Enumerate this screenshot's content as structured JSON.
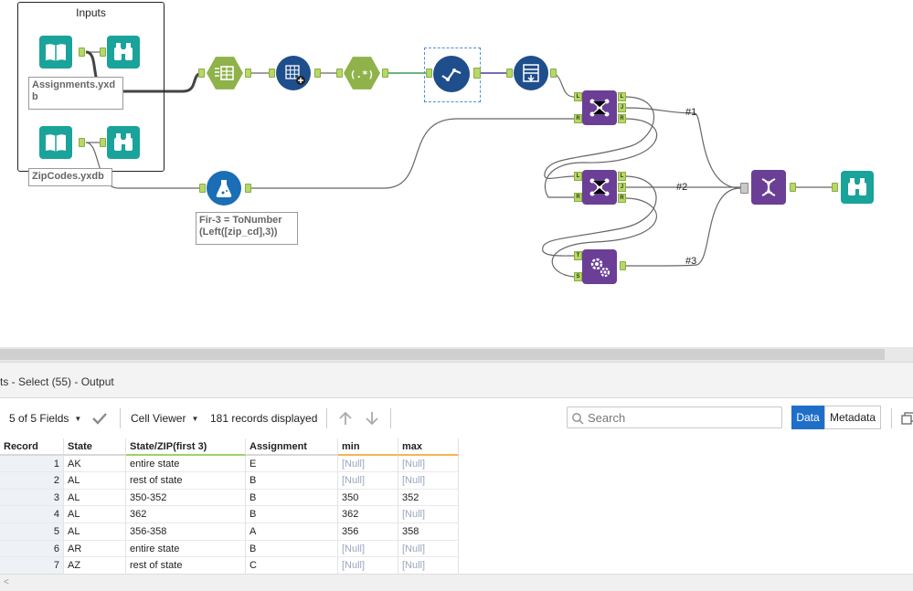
{
  "canvas": {
    "container_title": "Inputs",
    "annotations": {
      "assignments_file": "Assignments.yxd\nb",
      "zipcodes_file": "ZipCodes.yxdb",
      "formula": "Fir-3 = ToNumber\n(Left([zip_cd],3))"
    },
    "anchor_labels": {
      "left": "L",
      "join": "J",
      "right": "R",
      "target": "T",
      "source": "S"
    },
    "wire_labels": [
      "#1",
      "#2",
      "#3"
    ],
    "colors": {
      "teal": "#1aa39a",
      "olive": "#8fb24a",
      "navy": "#1f4e8c",
      "purple": "#6b3f96",
      "blue": "#1a6eb5"
    }
  },
  "panel": {
    "title": "ts - Select (55) - Output"
  },
  "toolbar": {
    "fields_label": "5 of 5 Fields",
    "viewer_label": "Cell Viewer",
    "records_label": "181 records displayed",
    "search_placeholder": "Search",
    "data_label": "Data",
    "metadata_label": "Metadata"
  },
  "table": {
    "columns": [
      "Record",
      "State",
      "State/ZIP(first 3)",
      "Assignment",
      "min",
      "max"
    ],
    "rows": [
      [
        "1",
        "AK",
        "entire state",
        "E",
        "[Null]",
        "[Null]"
      ],
      [
        "2",
        "AL",
        "rest of state",
        "B",
        "[Null]",
        "[Null]"
      ],
      [
        "3",
        "AL",
        "350-352",
        "B",
        "350",
        "352"
      ],
      [
        "4",
        "AL",
        "362",
        "B",
        "362",
        "[Null]"
      ],
      [
        "5",
        "AL",
        "356-358",
        "A",
        "356",
        "358"
      ],
      [
        "6",
        "AR",
        "entire state",
        "B",
        "[Null]",
        "[Null]"
      ],
      [
        "7",
        "AZ",
        "rest of state",
        "C",
        "[Null]",
        "[Null]"
      ]
    ]
  }
}
